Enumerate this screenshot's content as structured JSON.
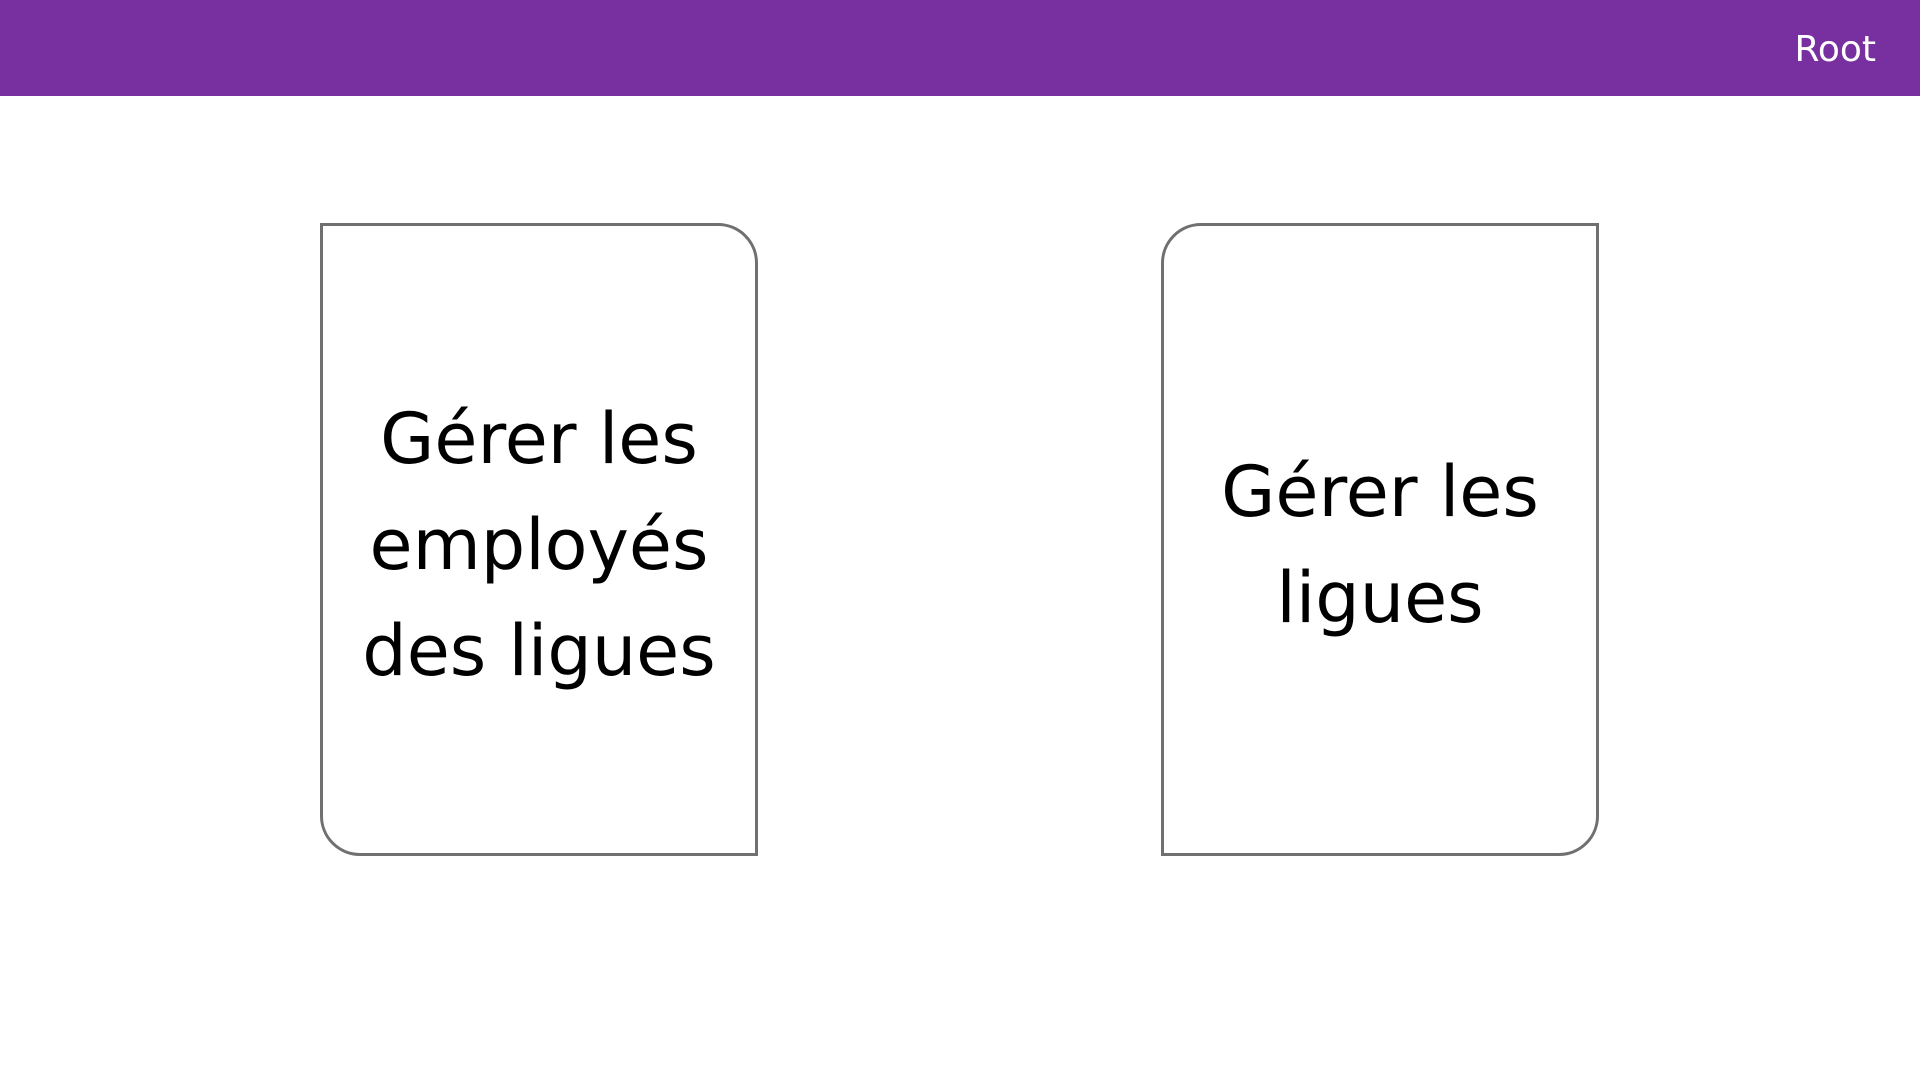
{
  "header": {
    "user_label": "Root",
    "background_color": "#7830a0"
  },
  "cards": [
    {
      "label": "Gérer les employés des ligues"
    },
    {
      "label": "Gérer les ligues"
    }
  ]
}
